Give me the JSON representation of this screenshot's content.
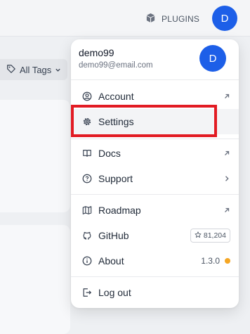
{
  "topbar": {
    "plugins_label": "PLUGINS",
    "avatar_initial": "D"
  },
  "filters": {
    "tags_label": "All Tags"
  },
  "menu": {
    "user": {
      "name": "demo99",
      "email": "demo99@email.com",
      "avatar_initial": "D"
    },
    "items": [
      {
        "label": "Account",
        "icon": "user-circle-icon",
        "trail": "external-link-icon"
      },
      {
        "label": "Settings",
        "icon": "gear-icon",
        "highlighted": true
      },
      {
        "label": "Docs",
        "icon": "book-icon",
        "trail": "external-link-icon"
      },
      {
        "label": "Support",
        "icon": "help-circle-icon",
        "trail": "chevron-right-icon"
      },
      {
        "label": "Roadmap",
        "icon": "map-icon",
        "trail": "external-link-icon"
      },
      {
        "label": "GitHub",
        "icon": "github-icon",
        "stars": "81,204"
      },
      {
        "label": "About",
        "icon": "info-icon",
        "version": "1.3.0",
        "update_available": true
      },
      {
        "label": "Log out",
        "icon": "logout-icon"
      }
    ]
  },
  "colors": {
    "avatar": "#1d5fe8",
    "highlight_box": "#e21b23",
    "update_dot": "#f5a623"
  }
}
